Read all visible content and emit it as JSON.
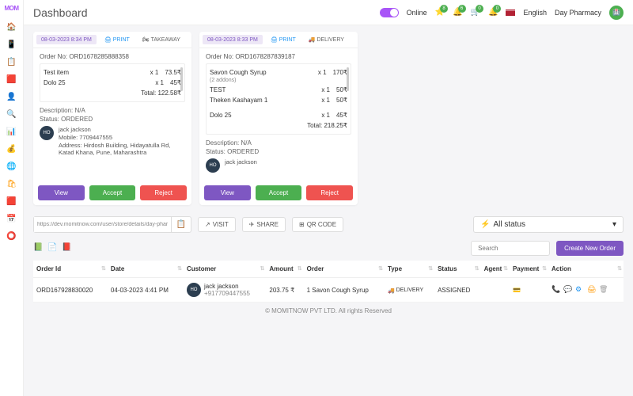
{
  "brand": "MOM",
  "page_title": "Dashboard",
  "header": {
    "online_label": "Online",
    "lang": "English",
    "pharmacy": "Day Pharmacy",
    "notif": {
      "a": "8",
      "b": "6",
      "c": "0",
      "d": "0"
    }
  },
  "orders": [
    {
      "dt": "08-03-2023 8:34 PM",
      "print": "PRINT",
      "mode": "TAKEAWAY",
      "mode_icon": "🏍",
      "order_no_label": "Order No:",
      "order_no": "ORD1678285888358",
      "items": [
        {
          "name": "Test item",
          "qty": "x 1",
          "price": "73.5₹",
          "addon": ""
        },
        {
          "name": "Dolo 25",
          "qty": "x 1",
          "price": "45₹",
          "addon": ""
        }
      ],
      "total_label": "Total:",
      "total": "122.58₹",
      "desc_label": "Description:",
      "desc": "N/A",
      "status_label": "Status:",
      "status": "ORDERED",
      "cust": {
        "name": "jack jackson",
        "mobile_label": "Mobile:",
        "mobile": "7709447555",
        "addr_label": "Address:",
        "addr": "Hirdosh Building, Hidayatulla Rd, Katad Khana, Pune, Maharashtra"
      },
      "view": "View",
      "accept": "Accept",
      "reject": "Reject"
    },
    {
      "dt": "08-03-2023 8:33 PM",
      "print": "PRINT",
      "mode": "DELIVERY",
      "mode_icon": "🚚",
      "order_no_label": "Order No:",
      "order_no": "ORD1678287839187",
      "items": [
        {
          "name": "Savon Cough Syrup",
          "addon": "(2 addons)",
          "qty": "x 1",
          "price": "170₹"
        },
        {
          "name": "TEST",
          "qty": "x 1",
          "price": "50₹",
          "addon": ""
        },
        {
          "name": "Theken Kashayam 1",
          "qty": "x 1",
          "price": "50₹",
          "addon": ""
        },
        {
          "name": "Dolo 25",
          "qty": "x 1",
          "price": "45₹",
          "addon": ""
        }
      ],
      "total_label": "Total:",
      "total": "218.25₹",
      "desc_label": "Description:",
      "desc": "N/A",
      "status_label": "Status:",
      "status": "ORDERED",
      "cust": {
        "name": "jack jackson",
        "mobile_label": "",
        "mobile": "",
        "addr_label": "",
        "addr": ""
      },
      "view": "View",
      "accept": "Accept",
      "reject": "Reject"
    }
  ],
  "toolbar": {
    "url": "https://dev.momitnow.com/user/store/details/day-pharmacy",
    "visit": "VISIT",
    "share": "SHARE",
    "qr": "QR CODE",
    "status_filter": "All status"
  },
  "list": {
    "search_ph": "Search",
    "new_btn": "Create New Order",
    "cols": [
      "Order Id",
      "Date",
      "Customer",
      "Amount",
      "Order",
      "Type",
      "Status",
      "Agent",
      "Payment",
      "Action"
    ],
    "rows": [
      {
        "id": "ORD167928830020",
        "date": "04-03-2023 4:41 PM",
        "cust_name": "jack jackson",
        "cust_phone": "+917709447555",
        "amount": "203.75 ₹",
        "order": "1 Savon Cough Syrup",
        "type": "DELIVERY",
        "status": "ASSIGNED",
        "agent": "",
        "payment": "💳"
      }
    ]
  },
  "footer": "© MOMITNOW PVT LTD. All rights Reserved"
}
